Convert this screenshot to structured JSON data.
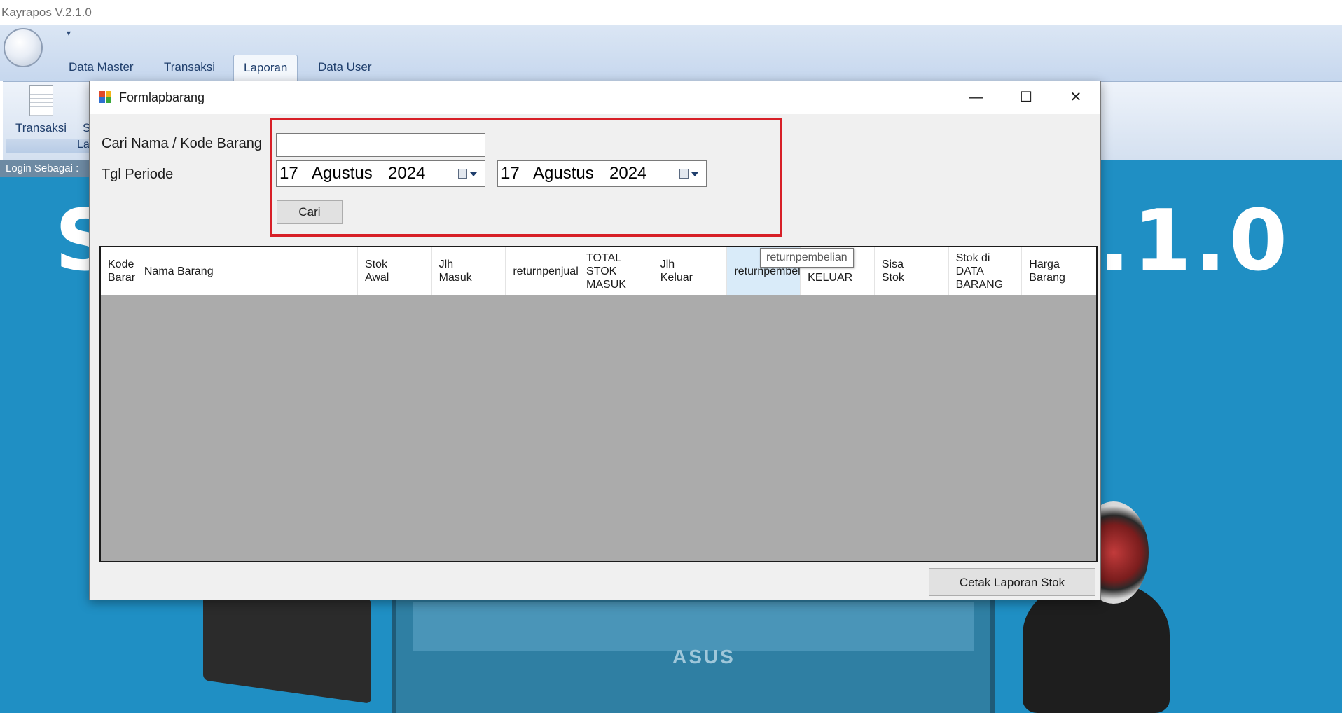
{
  "app": {
    "title": "Kayrapos V.2.1.0"
  },
  "ribbon": {
    "tabs": [
      {
        "label": "Data Master"
      },
      {
        "label": "Transaksi"
      },
      {
        "label": "Laporan"
      },
      {
        "label": "Data User"
      }
    ],
    "active_tab": "Laporan",
    "buttons": [
      {
        "label": "Transaksi"
      },
      {
        "label": "S"
      }
    ],
    "group_label": "La"
  },
  "workspace": {
    "login_label": "Login Sebagai :",
    "background_text_left": "S",
    "background_text_right": ".1.0",
    "laptop_brand": "ASUS"
  },
  "dialog": {
    "title": "Formlapbarang",
    "window_buttons": {
      "minimize": "—",
      "maximize": "☐",
      "close": "✕"
    },
    "search_label": "Cari Nama / Kode  Barang",
    "search_value": "",
    "period_label": "Tgl Periode",
    "date_from": {
      "day": "17",
      "month": "Agustus",
      "year": "2024"
    },
    "date_to": {
      "day": "17",
      "month": "Agustus",
      "year": "2024"
    },
    "search_button": "Cari",
    "grid_columns": [
      "Kode\nBarar",
      "Nama Barang",
      "Stok\nAwal",
      "Jlh\nMasuk",
      "returnpenjual",
      "TOTAL\nSTOK\nMASUK",
      "Jlh\nKeluar",
      "returnpembel",
      "STOK\nKELUAR",
      "Sisa\nStok",
      "Stok di\nDATA\nBARANG",
      "Harga\nBarang"
    ],
    "grid_rows": [],
    "tooltip": "returnpembelian",
    "print_button": "Cetak Laporan Stok"
  },
  "colors": {
    "highlight": "#d71f27",
    "workspace_bg": "#1f8fc4",
    "grid_empty_bg": "#ababab"
  }
}
